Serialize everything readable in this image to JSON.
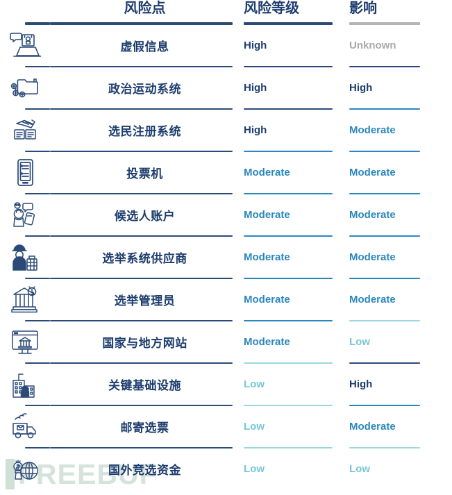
{
  "table": {
    "headers": {
      "icon": "",
      "risk_point": "风险点",
      "risk_level": "风险等级",
      "impact": "影响"
    },
    "header_rule_colors": {
      "icon": "#2b4a78",
      "risk_point": "#2b4a78",
      "risk_level": "#2b4a78",
      "impact": "#b3b3b3"
    },
    "legend_colors": {
      "High": "#1d3d6e",
      "Moderate": "#2a87bd",
      "Low": "#76c7d6",
      "Unknown": "#a9a9a9"
    },
    "rows": [
      {
        "icon": "laptop-speech-bubble-megaphone-icon",
        "name": "虚假信息",
        "level": "High",
        "level_class": "high",
        "impact": "Unknown",
        "impact_class": "unknown"
      },
      {
        "icon": "folder-network-nodes-icon",
        "name": "政治运动系统",
        "level": "High",
        "level_class": "high",
        "impact": "High",
        "impact_class": "high"
      },
      {
        "icon": "voter-registration-cards-icon",
        "name": "选民注册系统",
        "level": "High",
        "level_class": "high",
        "impact": "Moderate",
        "impact_class": "moderate"
      },
      {
        "icon": "voting-machine-tablet-icon",
        "name": "投票机",
        "level": "Moderate",
        "level_class": "moderate",
        "impact": "Moderate",
        "impact_class": "moderate"
      },
      {
        "icon": "candidate-account-phone-icon",
        "name": "候选人账户",
        "level": "Moderate",
        "level_class": "moderate",
        "impact": "Moderate",
        "impact_class": "moderate"
      },
      {
        "icon": "election-vendor-worker-icon",
        "name": "选举系统供应商",
        "level": "Moderate",
        "level_class": "moderate",
        "impact": "Moderate",
        "impact_class": "moderate"
      },
      {
        "icon": "election-official-building-icon",
        "name": "选举管理员",
        "level": "Moderate",
        "level_class": "moderate",
        "impact": "Moderate",
        "impact_class": "moderate"
      },
      {
        "icon": "government-website-monitor-icon",
        "name": "国家与地方网站",
        "level": "Moderate",
        "level_class": "moderate",
        "impact": "Low",
        "impact_class": "low"
      },
      {
        "icon": "critical-infrastructure-lock-icon",
        "name": "关键基础设施",
        "level": "Low",
        "level_class": "low",
        "impact": "High",
        "impact_class": "high"
      },
      {
        "icon": "mail-truck-ballot-icon",
        "name": "邮寄选票",
        "level": "Low",
        "level_class": "low",
        "impact": "Moderate",
        "impact_class": "moderate"
      },
      {
        "icon": "foreign-funding-globe-money-icon",
        "name": "国外竞选资金",
        "level": "Low",
        "level_class": "low",
        "impact": "Low",
        "impact_class": "low"
      }
    ]
  },
  "watermark": {
    "text": "FREEBUF"
  }
}
